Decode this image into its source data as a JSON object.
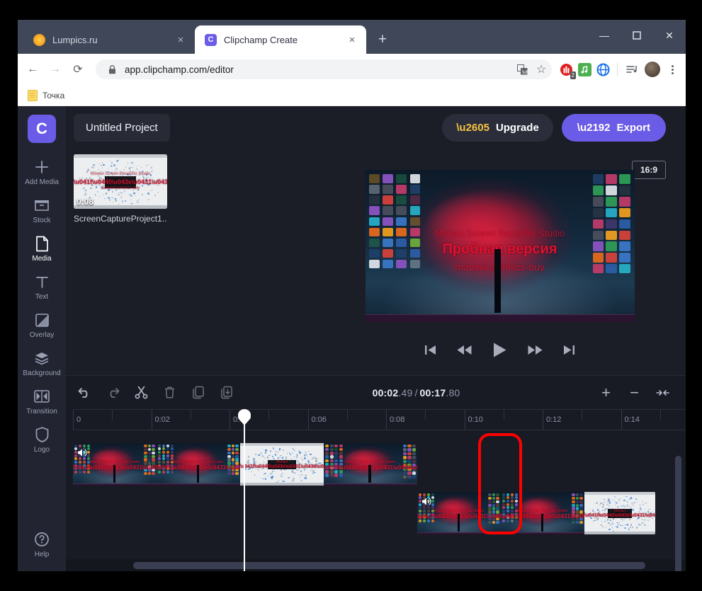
{
  "browser": {
    "tabs": [
      {
        "title": "Lumpics.ru",
        "favicon": "orange-circle-icon",
        "active": false,
        "close_label": "×"
      },
      {
        "title": "Clipchamp Create",
        "favicon": "clipchamp-c-icon",
        "active": true,
        "close_label": "×"
      }
    ],
    "new_tab_label": "+",
    "window_controls": {
      "minimize": "—",
      "maximize": "☐",
      "close": "✕"
    },
    "nav": {
      "back": "←",
      "forward": "→",
      "reload": "⟳"
    },
    "omnibox": {
      "lock_icon": "🔒",
      "url": "app.clipchamp.com/editor",
      "translate_icon": "translate-icon",
      "bookmark_icon": "☆"
    },
    "extensions": [
      {
        "name": "adblock-extension-icon",
        "badge": "2"
      },
      {
        "name": "music-extension-icon",
        "badge": ""
      },
      {
        "name": "globe-extension-icon",
        "badge": ""
      }
    ],
    "playlist_icon": "playlist-icon",
    "profile_icon": "avatar-icon",
    "menu_icon": "kebab-menu-icon",
    "bookmarks": [
      {
        "label": "Точка",
        "icon": "folder-icon"
      }
    ]
  },
  "app": {
    "logo": "C",
    "sidebar": [
      {
        "label": "Add Media",
        "icon": "plus-icon",
        "active": false
      },
      {
        "label": "Stock",
        "icon": "stock-icon",
        "active": false
      },
      {
        "label": "Media",
        "icon": "document-icon",
        "active": true
      },
      {
        "label": "Text",
        "icon": "text-t-icon",
        "active": false
      },
      {
        "label": "Overlay",
        "icon": "overlay-icon",
        "active": false
      },
      {
        "label": "Background",
        "icon": "layers-icon",
        "active": false
      },
      {
        "label": "Transition",
        "icon": "transition-icon",
        "active": false
      },
      {
        "label": "Logo",
        "icon": "shield-icon",
        "active": false
      },
      {
        "label": "Help",
        "icon": "question-icon",
        "active": false
      }
    ],
    "header": {
      "project_name": "Untitled Project",
      "upgrade_label": "Upgrade",
      "upgrade_icon": "star-icon",
      "export_label": "Export",
      "export_icon": "arrow-right-icon"
    },
    "media_library": [
      {
        "name": "ScreenCaptureProject1....",
        "duration": "0:08",
        "thumb_type": "white-explosion"
      }
    ],
    "preview": {
      "aspect_ratio": "16:9",
      "watermark_line1": "Movavi Screen Recorder Studio",
      "watermark_line2": "Пробная версия",
      "watermark_line3": "movavi.com/scs-buy"
    },
    "playback": [
      {
        "name": "skip-to-start-button",
        "glyph": "⏮"
      },
      {
        "name": "rewind-button",
        "glyph": "⏪"
      },
      {
        "name": "play-button",
        "glyph": "▶"
      },
      {
        "name": "fast-forward-button",
        "glyph": "⏩"
      },
      {
        "name": "skip-to-end-button",
        "glyph": "⏭"
      }
    ],
    "timeline": {
      "tools": [
        {
          "name": "undo-button",
          "glyph": "↶"
        },
        {
          "name": "redo-button",
          "glyph": "↷"
        },
        {
          "name": "split-button",
          "glyph": "✂"
        },
        {
          "name": "delete-button",
          "glyph": "🗑"
        },
        {
          "name": "duplicate-button",
          "glyph": "❐"
        },
        {
          "name": "download-clip-button",
          "glyph": "⤓"
        }
      ],
      "current_time": "00:02",
      "current_time_frac": ".49",
      "total_time": "00:17",
      "total_time_frac": ".80",
      "zoom_in_label": "+",
      "zoom_out_label": "−",
      "fit_label": "⇥⇤",
      "ruler_ticks": [
        "0",
        "0:02",
        "0:04",
        "0:06",
        "0:08",
        "0:10",
        "0:12",
        "0:14"
      ],
      "playhead_time": "00:02.49"
    },
    "annotation": {
      "color": "#ff0000",
      "shape": "rounded-rect"
    }
  },
  "colors": {
    "accent": "#6b5ce7",
    "app_bg": "#1c1e27",
    "rail_bg": "#222531",
    "timeline_bg": "#191b24",
    "annotation": "#ff0000",
    "selection": "#2a9fe0",
    "star": "#f5c341"
  }
}
